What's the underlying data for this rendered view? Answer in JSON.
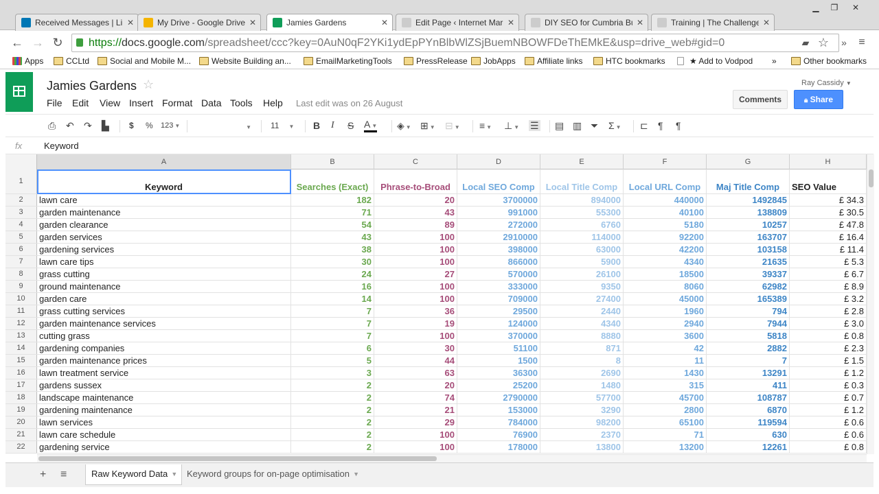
{
  "browser": {
    "tabs": [
      {
        "label": "Received Messages | Link",
        "favicon": "linkedin-icon",
        "favicon_color": "#0077b5"
      },
      {
        "label": "My Drive - Google Drive",
        "favicon": "drive-icon",
        "favicon_color": "#f4b400"
      },
      {
        "label": "Jamies Gardens",
        "favicon": "sheets-icon",
        "favicon_color": "#0f9d58"
      },
      {
        "label": "Edit Page ‹ Internet Mark",
        "favicon": "page-icon",
        "favicon_color": "#cccccc"
      },
      {
        "label": "DIY SEO for Cumbria Bus",
        "favicon": "page-icon",
        "favicon_color": "#cccccc"
      },
      {
        "label": "Training | The Challenge",
        "favicon": "page-icon",
        "favicon_color": "#cccccc"
      }
    ],
    "url_https": "https://",
    "url_host": "docs.google.com",
    "url_rest": "/spreadsheet/ccc?key=0AuN0qF2YKi1ydEpPYnBlbWlZSjBuemNBOWFDeThEMkE&usp=drive_web#gid=0",
    "bookmarks": [
      "Apps",
      "CCLtd",
      "Social and Mobile M...",
      "Website Building an...",
      "EmailMarketingTools",
      "PressRelease",
      "JobApps",
      "Affiliate links",
      "HTC bookmarks",
      "★ Add to Vodpod"
    ],
    "bookmarks_more": "»",
    "other_bookmarks": "Other bookmarks"
  },
  "sheets": {
    "title": "Jamies Gardens",
    "menu": [
      "File",
      "Edit",
      "View",
      "Insert",
      "Format",
      "Data",
      "Tools",
      "Help"
    ],
    "last_edit": "Last edit was on 26 August",
    "user": "Ray Cassidy",
    "comments_label": "Comments",
    "share_label": "Share",
    "toolbar": {
      "currency": "$",
      "percent": "%",
      "number_format": "123",
      "font_size": "11"
    },
    "formula_bar": {
      "fx": "fx",
      "content": "Keyword"
    },
    "columns": [
      "A",
      "B",
      "C",
      "D",
      "E",
      "F",
      "G",
      "H"
    ],
    "header_row": {
      "num": "1",
      "cells": [
        "Keyword",
        "Searches (Exact)",
        "Phrase-to-Broad",
        "Local SEO Comp",
        "Local Title Comp",
        "Local URL Comp",
        "Maj Title Comp",
        "SEO Value"
      ]
    },
    "column_colors": [
      "#222222",
      "#6aa84f",
      "#a64d79",
      "#6fa8dc",
      "#9fc5e8",
      "#6fa8dc",
      "#3d85c6",
      "#222222"
    ],
    "rows": [
      {
        "num": "2",
        "cells": [
          "lawn care",
          "182",
          "20",
          "3700000",
          "894000",
          "440000",
          "1492845",
          "£ 34.3"
        ]
      },
      {
        "num": "3",
        "cells": [
          "garden maintenance",
          "71",
          "43",
          "991000",
          "55300",
          "40100",
          "138809",
          "£ 30.5"
        ]
      },
      {
        "num": "4",
        "cells": [
          "garden clearance",
          "54",
          "89",
          "272000",
          "6760",
          "5180",
          "10257",
          "£ 47.8"
        ]
      },
      {
        "num": "5",
        "cells": [
          "garden services",
          "43",
          "100",
          "2910000",
          "114000",
          "92200",
          "163707",
          "£ 16.4"
        ]
      },
      {
        "num": "6",
        "cells": [
          "gardening services",
          "38",
          "100",
          "398000",
          "63000",
          "42200",
          "103158",
          "£ 11.4"
        ]
      },
      {
        "num": "7",
        "cells": [
          "lawn care tips",
          "30",
          "100",
          "866000",
          "5900",
          "4340",
          "21635",
          "£ 5.3"
        ]
      },
      {
        "num": "8",
        "cells": [
          "grass cutting",
          "24",
          "27",
          "570000",
          "26100",
          "18500",
          "39337",
          "£ 6.7"
        ]
      },
      {
        "num": "9",
        "cells": [
          "ground maintenance",
          "16",
          "100",
          "333000",
          "9350",
          "8060",
          "62982",
          "£ 8.9"
        ]
      },
      {
        "num": "10",
        "cells": [
          "garden care",
          "14",
          "100",
          "709000",
          "27400",
          "45000",
          "165389",
          "£ 3.2"
        ]
      },
      {
        "num": "11",
        "cells": [
          "grass cutting services",
          "7",
          "36",
          "29500",
          "2440",
          "1960",
          "794",
          "£ 2.8"
        ]
      },
      {
        "num": "12",
        "cells": [
          "garden maintenance services",
          "7",
          "19",
          "124000",
          "4340",
          "2940",
          "7944",
          "£ 3.0"
        ]
      },
      {
        "num": "13",
        "cells": [
          "cutting grass",
          "7",
          "100",
          "370000",
          "8880",
          "3600",
          "5818",
          "£ 0.8"
        ]
      },
      {
        "num": "14",
        "cells": [
          "gardening companies",
          "6",
          "30",
          "51100",
          "871",
          "42",
          "2882",
          "£ 2.3"
        ]
      },
      {
        "num": "15",
        "cells": [
          "garden maintenance prices",
          "5",
          "44",
          "1500",
          "8",
          "11",
          "7",
          "£ 1.5"
        ]
      },
      {
        "num": "16",
        "cells": [
          "lawn treatment service",
          "3",
          "63",
          "36300",
          "2690",
          "1430",
          "13291",
          "£ 1.2"
        ]
      },
      {
        "num": "17",
        "cells": [
          "gardens sussex",
          "2",
          "20",
          "25200",
          "1480",
          "315",
          "411",
          "£ 0.3"
        ]
      },
      {
        "num": "18",
        "cells": [
          "landscape maintenance",
          "2",
          "74",
          "2790000",
          "57700",
          "45700",
          "108787",
          "£ 0.7"
        ]
      },
      {
        "num": "19",
        "cells": [
          "gardening maintenance",
          "2",
          "21",
          "153000",
          "3290",
          "2800",
          "6870",
          "£ 1.2"
        ]
      },
      {
        "num": "20",
        "cells": [
          "lawn services",
          "2",
          "29",
          "784000",
          "98200",
          "65100",
          "119594",
          "£ 0.6"
        ]
      },
      {
        "num": "21",
        "cells": [
          "lawn care schedule",
          "2",
          "100",
          "76900",
          "2370",
          "71",
          "630",
          "£ 0.6"
        ]
      },
      {
        "num": "22",
        "cells": [
          "gardening service",
          "2",
          "100",
          "178000",
          "13800",
          "13200",
          "12261",
          "£ 0.8"
        ]
      }
    ],
    "sheet_tabs": [
      "Raw Keyword Data",
      "Keyword groups for on-page optimisation"
    ],
    "add_sheet": "+",
    "all_sheets": "≡"
  }
}
